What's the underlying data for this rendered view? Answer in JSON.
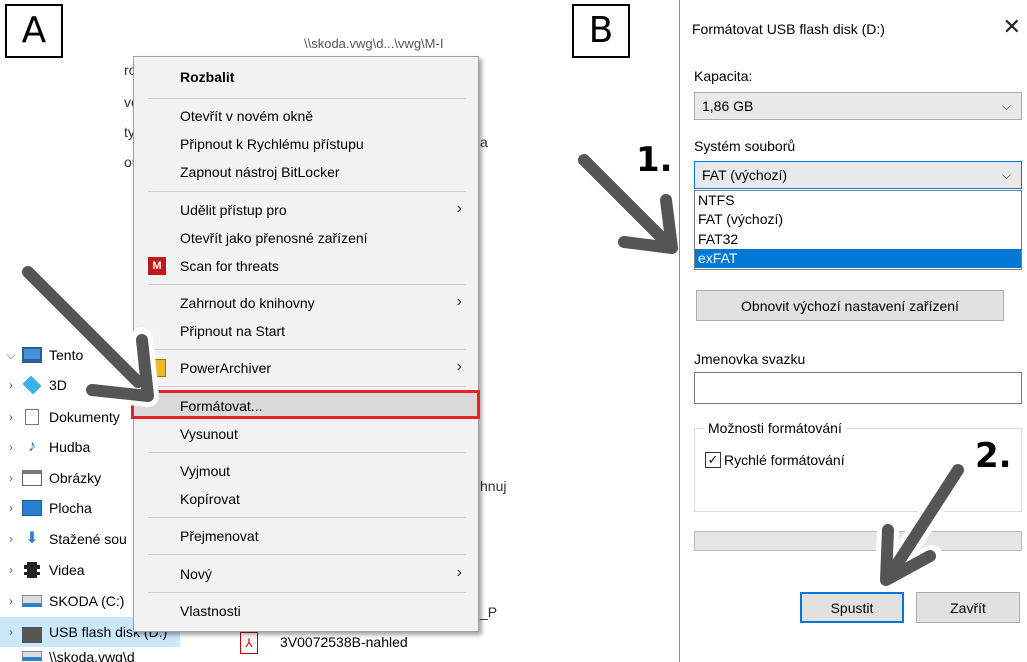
{
  "labels": {
    "panel_a": "A",
    "panel_b": "B",
    "step1": "1.",
    "step2": "2."
  },
  "explorer": {
    "fragments": [
      "\\\\skoda.vwg\\d...\\vwg\\M-I",
      "ro",
      "ve",
      "ty",
      "ou",
      "a",
      "hnuj",
      "_P"
    ],
    "tree": [
      {
        "label": "Tento",
        "chevron": "⌵",
        "icon": "pc-icon"
      },
      {
        "label": "3D",
        "chevron": "›",
        "icon": "cube-3d-icon"
      },
      {
        "label": "Dokumenty",
        "chevron": "›",
        "icon": "document-icon"
      },
      {
        "label": "Hudba",
        "chevron": "›",
        "icon": "music-icon"
      },
      {
        "label": "Obrázky",
        "chevron": "›",
        "icon": "picture-icon"
      },
      {
        "label": "Plocha",
        "chevron": "›",
        "icon": "desktop-icon"
      },
      {
        "label": "Stažené sou",
        "chevron": "›",
        "icon": "download-icon"
      },
      {
        "label": "Videa",
        "chevron": "›",
        "icon": "video-icon"
      },
      {
        "label": "SKODA (C:)",
        "chevron": "›",
        "icon": "drive-icon"
      },
      {
        "label": "USB flash disk (D:)",
        "chevron": "›",
        "icon": "usb-drive-icon"
      },
      {
        "label": "\\\\skoda.vwg\\d",
        "chevron": "",
        "icon": "network-drive-icon"
      }
    ],
    "file_row": "3V0072538B-nahled",
    "file_icon_glyph": "⅄"
  },
  "context_menu": {
    "expand": "Rozbalit",
    "open_new_window": "Otevřít v novém okně",
    "pin_quick_access": "Připnout k Rychlému přístupu",
    "bitlocker": "Zapnout nástroj BitLocker",
    "grant_access": "Udělit přístup pro",
    "open_portable": "Otevřít jako přenosné zařízení",
    "scan_threats": "Scan for threats",
    "mcafee_glyph": "M",
    "include_library": "Zahrnout do knihovny",
    "pin_start": "Připnout na Start",
    "powerarchiver": "PowerArchiver",
    "format": "Formátovat...",
    "eject": "Vysunout",
    "cut": "Vyjmout",
    "copy": "Kopírovat",
    "rename": "Přejmenovat",
    "new": "Nový",
    "properties": "Vlastnosti",
    "submenu_arrow": "›"
  },
  "dialog": {
    "title": "Formátovat USB flash disk (D:)",
    "close_glyph": "✕",
    "capacity_label": "Kapacita:",
    "capacity_value": "1,86 GB",
    "filesystem_label": "Systém souborů",
    "filesystem_value": "FAT (výchozí)",
    "filesystem_options": [
      "NTFS",
      "FAT (výchozí)",
      "FAT32",
      "exFAT"
    ],
    "caret_glyph": "⌵",
    "restore_defaults": "Obnovit výchozí nastavení zařízení",
    "volume_label": "Jmenovka svazku",
    "volume_value": "",
    "format_options_legend": "Možnosti formátování",
    "quick_format": "Rychlé formátování",
    "quick_format_checked": true,
    "check_glyph": "✓",
    "progress_percent": 0,
    "start_button": "Spustit",
    "close_button": "Zavřít"
  },
  "colors": {
    "highlight_red": "#e8202a",
    "accent_blue": "#0078d7",
    "arrow_gray": "#555555"
  }
}
